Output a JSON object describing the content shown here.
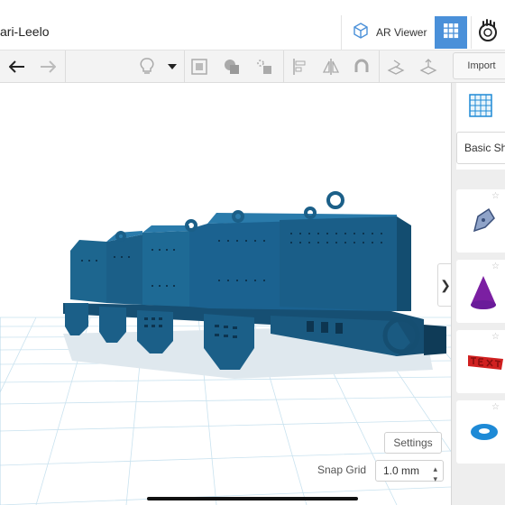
{
  "header": {
    "project_name": "ari-Leelo",
    "ar_viewer_label": "AR Viewer"
  },
  "toolbar": {
    "import_label": "Import",
    "icons": [
      "undo-icon",
      "redo-icon",
      "lightbulb-icon",
      "dropdown-caret-icon",
      "group-icon",
      "shape-icon",
      "ungroup-icon",
      "align-icon",
      "mirror-icon",
      "magnet-icon",
      "workplane-icon",
      "ruler-icon"
    ]
  },
  "viewport": {
    "settings_label": "Settings",
    "snap_grid_label": "Snap Grid",
    "snap_grid_value": "1.0 mm"
  },
  "panel": {
    "shapes_category": "Basic Shapes",
    "shape_icons": [
      "grid-shape-icon",
      "scribble-shape-icon",
      "cone-shape-icon",
      "text-shape-icon",
      "torus-shape-icon"
    ]
  },
  "colors": {
    "accent": "#4a90d9",
    "model_blue": "#1b5f88",
    "grid_line": "#c9e2ef",
    "cone_purple": "#7b1fa2",
    "text_shape_red": "#d02020",
    "torus_blue": "#1e8ad6"
  }
}
